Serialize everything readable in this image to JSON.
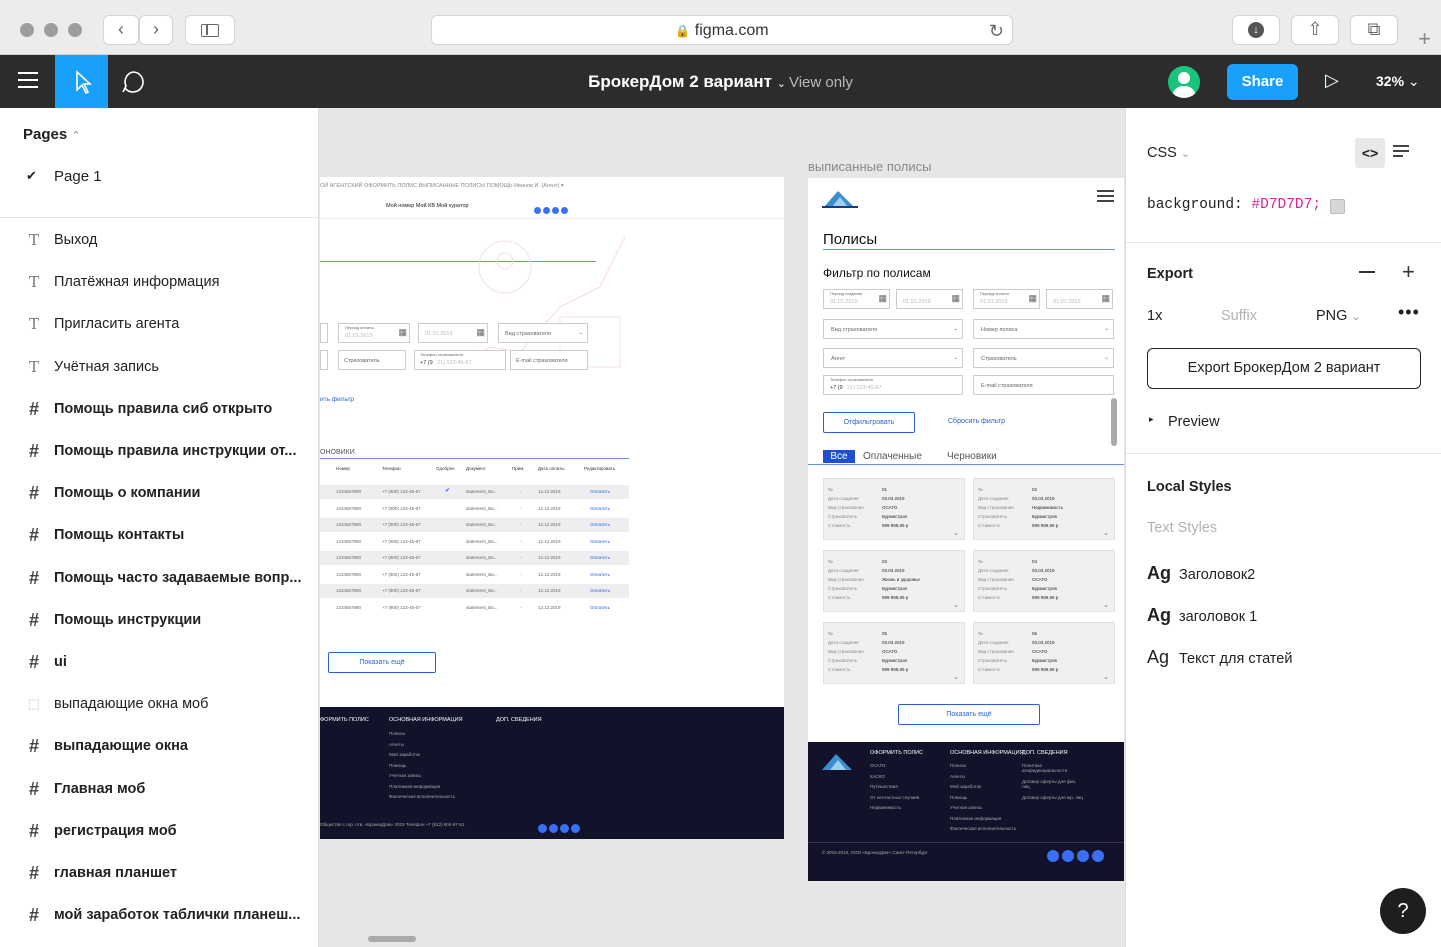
{
  "browser": {
    "url": "figma.com",
    "new_tab": "+"
  },
  "toolbar": {
    "file_title": "БрокерДом 2 вариант",
    "view_only": "View only",
    "share": "Share",
    "zoom": "32%"
  },
  "pages": {
    "header": "Pages",
    "current": "Page 1"
  },
  "layers": [
    {
      "type": "text",
      "name": "Выход"
    },
    {
      "type": "text",
      "name": "Платёжная информация"
    },
    {
      "type": "text",
      "name": "Пригласить агента"
    },
    {
      "type": "text",
      "name": "Учётная запись"
    },
    {
      "type": "frame",
      "name": "Помощь правила сиб открыто"
    },
    {
      "type": "frame",
      "name": "Помощь правила инструкции от..."
    },
    {
      "type": "frame",
      "name": "Помощь о компании"
    },
    {
      "type": "frame",
      "name": "Помощь контакты"
    },
    {
      "type": "frame",
      "name": "Помощь часто задаваемые вопр..."
    },
    {
      "type": "frame",
      "name": "Помощь инструкции"
    },
    {
      "type": "frame",
      "name": "ui"
    },
    {
      "type": "group",
      "name": "выпадающие окна моб"
    },
    {
      "type": "frame",
      "name": "выпадающие окна"
    },
    {
      "type": "frame",
      "name": "Главная моб"
    },
    {
      "type": "frame",
      "name": "регистрация моб"
    },
    {
      "type": "frame",
      "name": "главная планшет"
    },
    {
      "type": "frame",
      "name": "мой заработок таблички планеш..."
    }
  ],
  "inspect": {
    "mode": "CSS",
    "css_prop": "background:",
    "css_val": "#D7D7D7;",
    "swatch": "#D7D7D7"
  },
  "export": {
    "title": "Export",
    "scale": "1x",
    "suffix": "Suffix",
    "format": "PNG",
    "button": "Export БрокерДом 2 вариант",
    "preview": "Preview"
  },
  "styles": {
    "title": "Local Styles",
    "text_styles": "Text Styles",
    "items": [
      {
        "glyph": "Ag",
        "name": "Заголовок2"
      },
      {
        "glyph": "Ag",
        "name": "заголовок 1"
      },
      {
        "glyph": "Ag",
        "name": "Текст для статей"
      }
    ]
  },
  "help": "?",
  "frames": {
    "desktop": {
      "menu": "Мой номер   Мой КВ   Мой куратор",
      "f_insurer": "Страхователь",
      "f_phone_label": "Телефон страхователя",
      "f_phone": "+7 (9",
      "f_phone_ph": "21) 123-45-67",
      "f_email": "E-mail страхователя",
      "f_type": "Вид страхователя",
      "date1": "01.01.2019",
      "date2": "01.01.2019",
      "period": "Период оплаты",
      "link": "ить фильтр",
      "tab": "ОНОВИКИ",
      "headers": [
        "Номер",
        "Телефон",
        "Одобрен",
        "Документ",
        "Прим.",
        "Дата оплаты",
        "Редактировать"
      ],
      "row": [
        "1234567890",
        "+7 (900) 123-45-67",
        "statement_Ba...",
        "12.12.2019",
        "Оплатить"
      ],
      "more": "Показать ещё",
      "footer_cols": [
        "ФОРМИТЬ ПОЛИС",
        "ОСНОВНАЯ ИНФОРМАЦИЯ",
        "ДОП. СВЕДЕНИЯ"
      ],
      "footer_links": [
        "Полисы",
        "Агенты",
        "Мой заработок",
        "Помощь",
        "Учетная запись",
        "Платежная информация",
        "Фактическая исполнительность"
      ]
    },
    "mobile": {
      "label": "выписанные полисы",
      "heading": "Полисы",
      "filter": "Фильтр по полисам",
      "period1": "Период создания",
      "period2": "Период оплаты",
      "date": "01.01.2019",
      "f_type": "Вид страхователя",
      "f_number": "Номер полиса",
      "f_agent": "Агент",
      "f_insurer": "Страхователь",
      "f_phone_label": "Телефон страхователя",
      "f_phone": "+7 (9",
      "f_phone_ph": "21) 123-45-67",
      "f_email": "E-mail страхователя",
      "btn_filter": "Отфильтровать",
      "btn_reset": "Сбросить фильтр",
      "tabs": [
        "Все",
        "Оплаченные",
        "Черновики"
      ],
      "card_labels": [
        "№",
        "Дата создания",
        "Вид страхования",
        "Страхователь",
        "Стоимость"
      ],
      "cards": [
        {
          "num": "01",
          "date": "03.03.2019",
          "kind": "ОСАГО",
          "who": "Бурмистров",
          "price": "999 999,99 р"
        },
        {
          "num": "02",
          "date": "03.03.2019",
          "kind": "Недвижимость",
          "who": "Бурмистров",
          "price": "999 999,99 р"
        },
        {
          "num": "03",
          "date": "03.03.2019",
          "kind": "Жизнь и здоровье",
          "who": "Бурмистров",
          "price": "999 999,99 р"
        },
        {
          "num": "04",
          "date": "03.03.2019",
          "kind": "ОСАГО",
          "who": "Бурмистров",
          "price": "999 999,99 р"
        },
        {
          "num": "05",
          "date": "03.03.2019",
          "kind": "ОСАГО",
          "who": "Бурмистров",
          "price": "999 999,99 р"
        },
        {
          "num": "06",
          "date": "03.03.2019",
          "kind": "ОСАГО",
          "who": "Бурмистров",
          "price": "999 999,99 р"
        }
      ],
      "more": "Показать ещё",
      "footer_cols": [
        "ОФОРМИТЬ ПОЛИС",
        "ОСНОВНАЯ ИНФОРМАЦИЯ",
        "ДОП. СВЕДЕНИЯ"
      ],
      "footer_col1": [
        "ОСАГО",
        "КАСКО",
        "Путешествия",
        "От несчастных случаев",
        "Недвижимость"
      ],
      "footer_col2": [
        "Полисы",
        "Агенты",
        "Мой заработок",
        "Помощь",
        "Учетная запись",
        "Платежная информация",
        "Фактическая исполнительность"
      ],
      "footer_col3": [
        "Политика конфиденциальности",
        "Договор оферты для физ. лиц",
        "Договор оферты для юр. лиц"
      ]
    }
  },
  "colors": {
    "accent": "#18a0fb",
    "toolbar": "#2c2c2c",
    "footer": "#12122b",
    "css_value": "#D7259A"
  }
}
